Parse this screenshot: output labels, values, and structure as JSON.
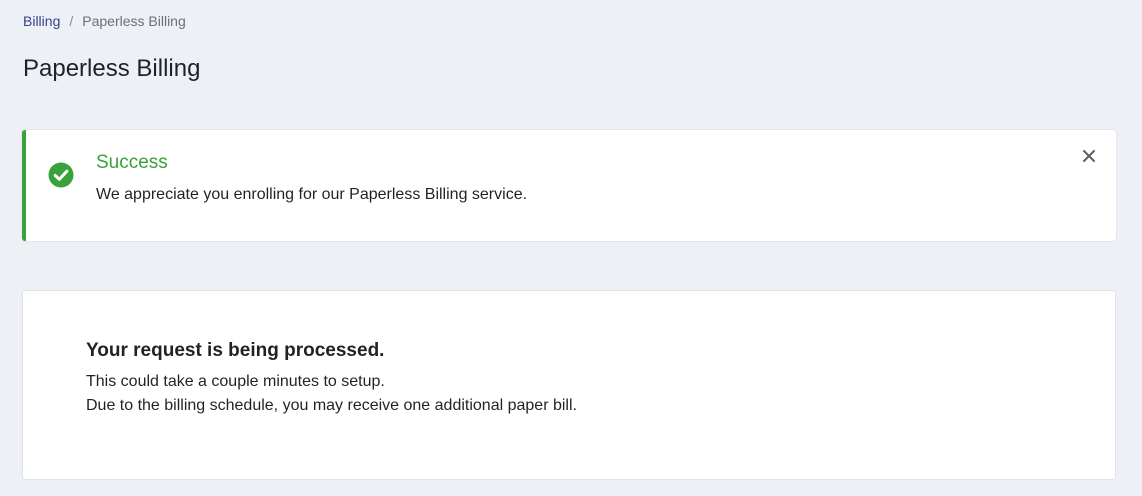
{
  "breadcrumb": {
    "parent": "Billing",
    "separator": "/",
    "current": "Paperless Billing"
  },
  "page": {
    "title": "Paperless Billing"
  },
  "alert": {
    "status": "success",
    "icon": "check-circle-icon",
    "title": "Success",
    "message": "We appreciate you enrolling for our Paperless Billing service.",
    "close_icon": "close-icon",
    "accent_color": "#3aa23a"
  },
  "processing_card": {
    "heading": "Your request is being processed.",
    "lines": [
      "This could take a couple minutes to setup.",
      "Due to the billing schedule, you may receive one additional paper bill."
    ]
  },
  "colors": {
    "background": "#edf0f4",
    "link": "#3b3f8f",
    "success": "#3aa23a",
    "text": "#1f2328"
  }
}
